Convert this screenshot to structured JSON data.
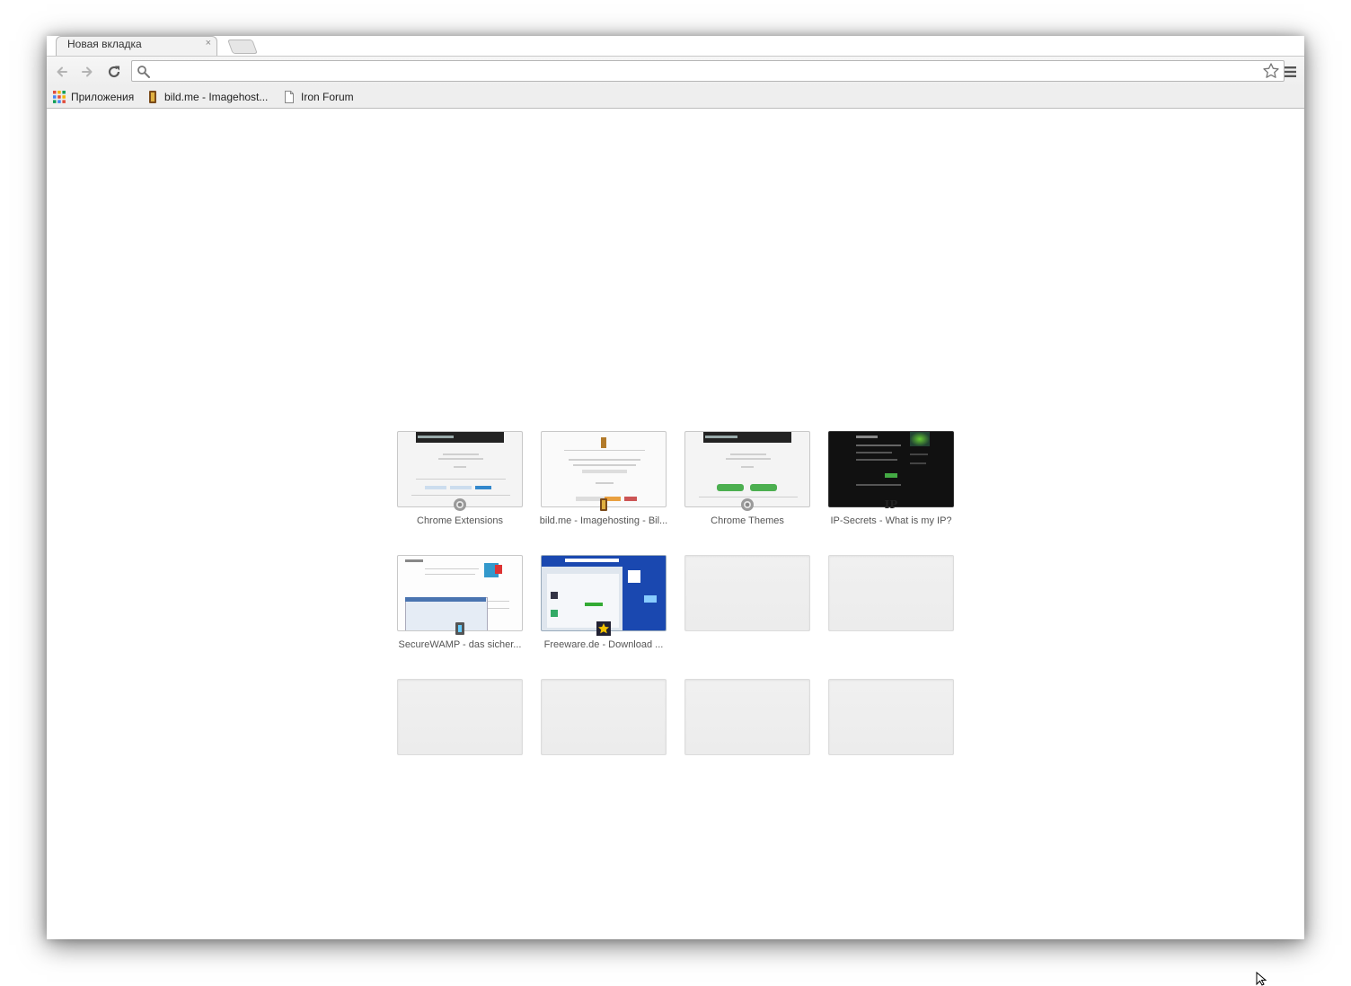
{
  "tab": {
    "title": "Новая вкладка",
    "close": "×"
  },
  "omnibox": {
    "value": "",
    "placeholder": ""
  },
  "bookmarks": [
    {
      "label": "Приложения",
      "icon": "apps-grid-icon"
    },
    {
      "label": "bild.me - Imagehost...",
      "icon": "bildme-favicon"
    },
    {
      "label": "Iron Forum",
      "icon": "page-icon"
    }
  ],
  "most_visited": [
    {
      "title": "Chrome Extensions",
      "favicon": "chrome-web-store-icon",
      "theme": "light"
    },
    {
      "title": "bild.me - Imagehosting - Bil...",
      "favicon": "bildme-favicon",
      "theme": "light"
    },
    {
      "title": "Chrome Themes",
      "favicon": "chrome-web-store-icon",
      "theme": "light"
    },
    {
      "title": "IP-Secrets - What is my IP?",
      "favicon": "ip-secrets-favicon",
      "theme": "dark"
    },
    {
      "title": "SecureWAMP - das sicher...",
      "favicon": "securewamp-favicon",
      "theme": "light"
    },
    {
      "title": "Freeware.de - Download ...",
      "favicon": "freeware-star-icon",
      "theme": "blue"
    },
    {
      "title": "",
      "empty": true
    },
    {
      "title": "",
      "empty": true
    },
    {
      "title": "",
      "empty": true
    },
    {
      "title": "",
      "empty": true
    },
    {
      "title": "",
      "empty": true
    },
    {
      "title": "",
      "empty": true
    }
  ],
  "colors": {
    "accent_blue": "#1a48b0",
    "dark_thumb": "#111111",
    "bookmark_bar": "#eeeeee"
  }
}
